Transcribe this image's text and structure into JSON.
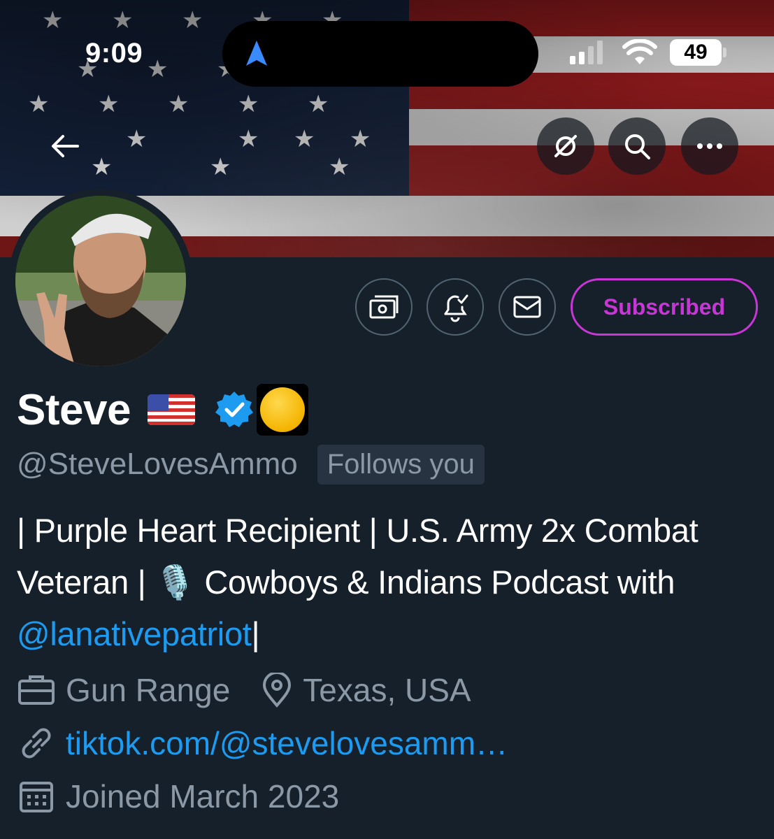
{
  "status_bar": {
    "time": "9:09",
    "battery": "49"
  },
  "profile": {
    "display_name": "Steve",
    "handle": "@SteveLovesAmmo",
    "follows_you": "Follows you",
    "subscribe_label": "Subscribed",
    "bio_text": "| Purple Heart Recipient | U.S. Army 2x Combat Veteran | 🎙️ Cowboys & Indians Podcast with ",
    "bio_mention": "@lanativepatriot",
    "bio_tail": "|",
    "category": "Gun Range",
    "location": "Texas, USA",
    "website": "tiktok.com/@stevelovesamm…",
    "joined": "Joined March 2023"
  },
  "icons": {
    "back": "arrow-left-icon",
    "grok": "grok-icon",
    "search": "search-icon",
    "more": "more-icon",
    "tip": "money-icon",
    "notify": "bell-check-icon",
    "message": "envelope-icon",
    "verified": "verified-badge-icon",
    "affiliate": "affiliate-badge-icon",
    "category": "briefcase-icon",
    "location": "location-pin-icon",
    "website": "link-icon",
    "joined": "calendar-icon"
  },
  "colors": {
    "background": "#15202b",
    "accent": "#1d9bf0",
    "subscribed": "#c936d6",
    "muted": "#8b98a5"
  }
}
